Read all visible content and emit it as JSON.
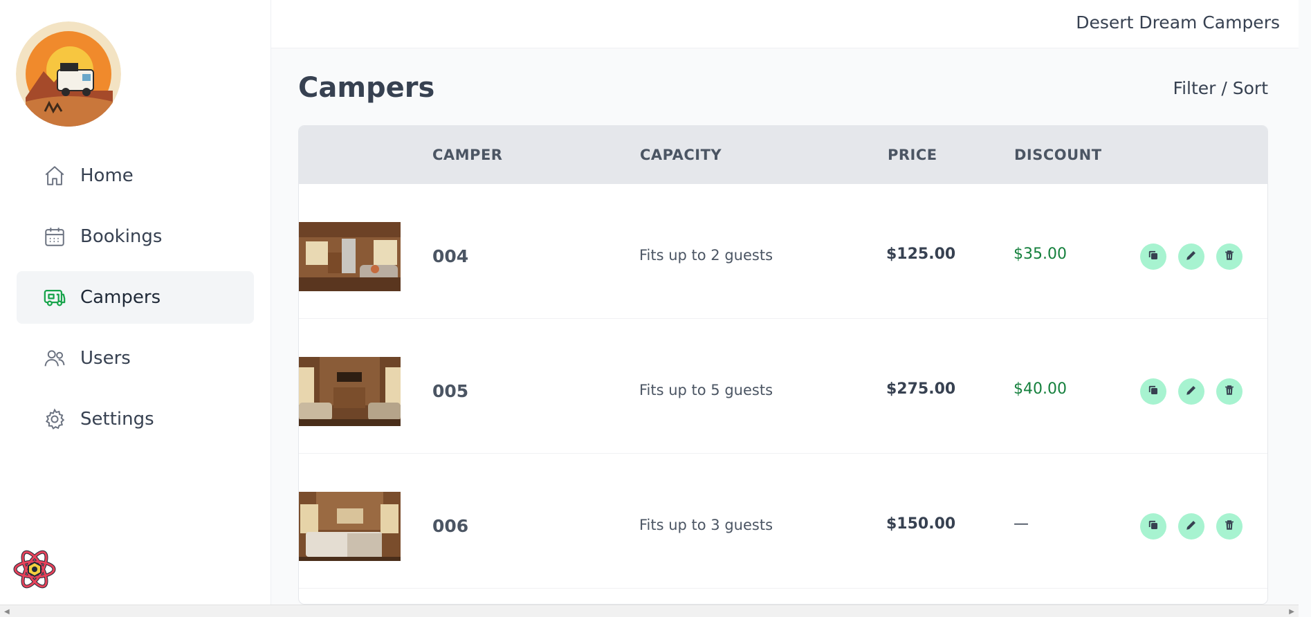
{
  "brand": "Desert Dream Campers",
  "page": {
    "title": "Campers",
    "filter_sort": "Filter / Sort"
  },
  "sidebar": {
    "items": [
      {
        "label": "Home",
        "icon": "home-icon"
      },
      {
        "label": "Bookings",
        "icon": "calendar-icon"
      },
      {
        "label": "Campers",
        "icon": "camper-icon",
        "active": true
      },
      {
        "label": "Users",
        "icon": "users-icon"
      },
      {
        "label": "Settings",
        "icon": "gear-icon"
      }
    ]
  },
  "table": {
    "headers": [
      "CAMPER",
      "CAPACITY",
      "PRICE",
      "DISCOUNT"
    ],
    "rows": [
      {
        "camper": "004",
        "capacity": "Fits up to 2 guests",
        "price": "$125.00",
        "discount": "$35.00"
      },
      {
        "camper": "005",
        "capacity": "Fits up to 5 guests",
        "price": "$275.00",
        "discount": "$40.00"
      },
      {
        "camper": "006",
        "capacity": "Fits up to 3 guests",
        "price": "$150.00",
        "discount": "—"
      }
    ]
  },
  "colors": {
    "accent": "#16a34a",
    "discount": "#15803d",
    "action_bg": "#a7f3d0",
    "header_bg": "#e5e7eb"
  }
}
